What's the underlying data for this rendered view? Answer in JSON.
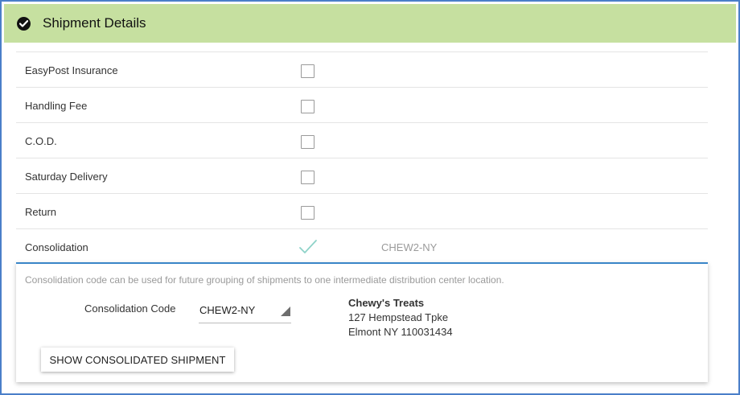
{
  "header": {
    "title": "Shipment Details",
    "icon": "check-circle-icon"
  },
  "options": [
    {
      "label": "EasyPost Insurance",
      "checked": false
    },
    {
      "label": "Handling Fee",
      "checked": false
    },
    {
      "label": "C.O.D.",
      "checked": false
    },
    {
      "label": "Saturday Delivery",
      "checked": false
    },
    {
      "label": "Return",
      "checked": false
    }
  ],
  "consolidation": {
    "label": "Consolidation",
    "checked": true,
    "value": "CHEW2-NY",
    "hint": "Consolidation code can be used for future grouping of shipments to one intermediate distribution center location.",
    "code_label": "Consolidation Code",
    "code_value": "CHEW2-NY",
    "address": {
      "name": "Chewy's Treats",
      "line1": "127 Hempstead Tpke",
      "line2": "Elmont NY 110031434"
    },
    "button_label": "SHOW CONSOLIDATED SHIPMENT"
  },
  "colors": {
    "header_bg": "#c6e0a0",
    "frame_border": "#4a7fc9",
    "panel_accent": "#3a86c8",
    "tick": "#8fd3c9"
  }
}
